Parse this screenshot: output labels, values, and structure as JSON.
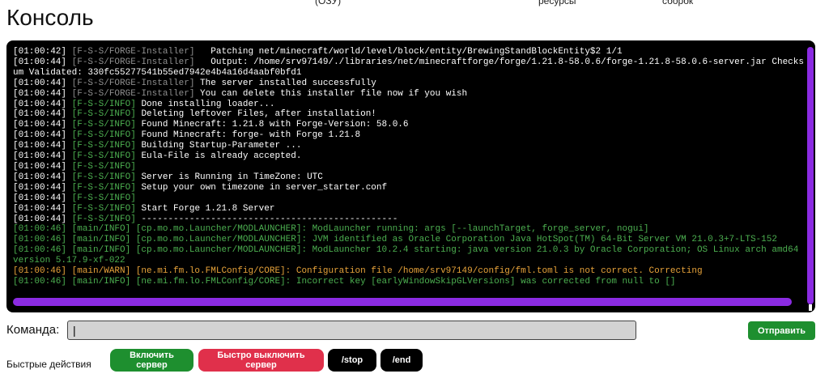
{
  "top_labels": [
    "(ОЗУ)",
    "ресурсы",
    "сборок"
  ],
  "page_title": "Консоль",
  "console": {
    "lines": [
      [
        {
          "t": "[01:00:42] ",
          "c": "white"
        },
        {
          "t": "[F-S-S/FORGE-Installer]",
          "c": "tag-gray"
        },
        {
          "t": "   Patching net/minecraft/world/level/block/entity/BrewingStandBlockEntity$2 1/1",
          "c": "white"
        }
      ],
      [
        {
          "t": "[01:00:44] ",
          "c": "white"
        },
        {
          "t": "[F-S-S/FORGE-Installer]",
          "c": "tag-gray"
        },
        {
          "t": "   Output: /home/srv97149/./libraries/net/minecraftforge/forge/1.21.8-58.0.6/forge-1.21.8-58.0.6-server.jar Checksum Validated: 330fc55277541b55ed7942e4b4a16d4aabf0bfd1",
          "c": "white"
        }
      ],
      [
        {
          "t": "[01:00:44] ",
          "c": "white"
        },
        {
          "t": "[F-S-S/FORGE-Installer]",
          "c": "tag-gray"
        },
        {
          "t": " The server installed successfully",
          "c": "white"
        }
      ],
      [
        {
          "t": "[01:00:44] ",
          "c": "white"
        },
        {
          "t": "[F-S-S/FORGE-Installer]",
          "c": "tag-gray"
        },
        {
          "t": " You can delete this installer file now if you wish",
          "c": "white"
        }
      ],
      [
        {
          "t": "[01:00:44] ",
          "c": "white"
        },
        {
          "t": "[F-S-S/INFO]",
          "c": "tag-green"
        },
        {
          "t": " Done installing loader...",
          "c": "white"
        }
      ],
      [
        {
          "t": "[01:00:44] ",
          "c": "white"
        },
        {
          "t": "[F-S-S/INFO]",
          "c": "tag-green"
        },
        {
          "t": " Deleting leftover Files, after installation!",
          "c": "white"
        }
      ],
      [
        {
          "t": "[01:00:44] ",
          "c": "white"
        },
        {
          "t": "[F-S-S/INFO]",
          "c": "tag-green"
        },
        {
          "t": " Found Minecraft: 1.21.8 with Forge-Version: 58.0.6",
          "c": "white"
        }
      ],
      [
        {
          "t": "[01:00:44] ",
          "c": "white"
        },
        {
          "t": "[F-S-S/INFO]",
          "c": "tag-green"
        },
        {
          "t": " Found Minecraft: forge- with Forge 1.21.8",
          "c": "white"
        }
      ],
      [
        {
          "t": "[01:00:44] ",
          "c": "white"
        },
        {
          "t": "[F-S-S/INFO]",
          "c": "tag-green"
        },
        {
          "t": " Building Startup-Parameter ...",
          "c": "white"
        }
      ],
      [
        {
          "t": "[01:00:44] ",
          "c": "white"
        },
        {
          "t": "[F-S-S/INFO]",
          "c": "tag-green"
        },
        {
          "t": " Eula-File is already accepted.",
          "c": "white"
        }
      ],
      [
        {
          "t": "[01:00:44] ",
          "c": "white"
        },
        {
          "t": "[F-S-S/INFO]",
          "c": "tag-green"
        }
      ],
      [
        {
          "t": "[01:00:44] ",
          "c": "white"
        },
        {
          "t": "[F-S-S/INFO]",
          "c": "tag-green"
        },
        {
          "t": " Server is Running in TimeZone: UTC",
          "c": "white"
        }
      ],
      [
        {
          "t": "[01:00:44] ",
          "c": "white"
        },
        {
          "t": "[F-S-S/INFO]",
          "c": "tag-green"
        },
        {
          "t": " Setup your own timezone in server_starter.conf",
          "c": "white"
        }
      ],
      [
        {
          "t": "[01:00:44] ",
          "c": "white"
        },
        {
          "t": "[F-S-S/INFO]",
          "c": "tag-green"
        }
      ],
      [
        {
          "t": "[01:00:44] ",
          "c": "white"
        },
        {
          "t": "[F-S-S/INFO]",
          "c": "tag-green"
        },
        {
          "t": " Start Forge 1.21.8 Server",
          "c": "white"
        }
      ],
      [
        {
          "t": "[01:00:44] ",
          "c": "white"
        },
        {
          "t": "[F-S-S/INFO]",
          "c": "tag-green"
        },
        {
          "t": " ------------------------------------------------",
          "c": "white"
        }
      ],
      [
        {
          "t": "[01:00:46] [main/INFO] [cp.mo.mo.Launcher/MODLAUNCHER]: ModLauncher running: args [--launchTarget, forge_server, nogui]",
          "c": "green"
        }
      ],
      [
        {
          "t": "[01:00:46] [main/INFO] [cp.mo.mo.Launcher/MODLAUNCHER]: JVM identified as Oracle Corporation Java HotSpot(TM) 64-Bit Server VM 21.0.3+7-LTS-152",
          "c": "green"
        }
      ],
      [
        {
          "t": "[01:00:46] [main/INFO] [cp.mo.mo.Launcher/MODLAUNCHER]: ModLauncher 10.2.4 starting: java version 21.0.3 by Oracle Corporation; OS Linux arch amd64 version 5.17.9-xf-022",
          "c": "green"
        }
      ],
      [
        {
          "t": "[01:00:46] [main/WARN] [ne.mi.fm.lo.FMLConfig/CORE]: Configuration file /home/srv97149/config/fml.toml is not correct. Correcting",
          "c": "orange"
        }
      ],
      [
        {
          "t": "[01:00:46] [main/INFO] [ne.mi.fm.lo.FMLConfig/CORE]: Incorrect key [earlyWindowSkipGLVersions] was corrected from null to []",
          "c": "green"
        }
      ]
    ]
  },
  "command": {
    "label": "Команда:",
    "value": "|",
    "send_label": "Отправить"
  },
  "quick_actions": {
    "label": "Быстрые действия",
    "start": "Включить сервер",
    "stop_fast": "Быстро выключить сервер",
    "stop": "/stop",
    "end": "/end"
  }
}
